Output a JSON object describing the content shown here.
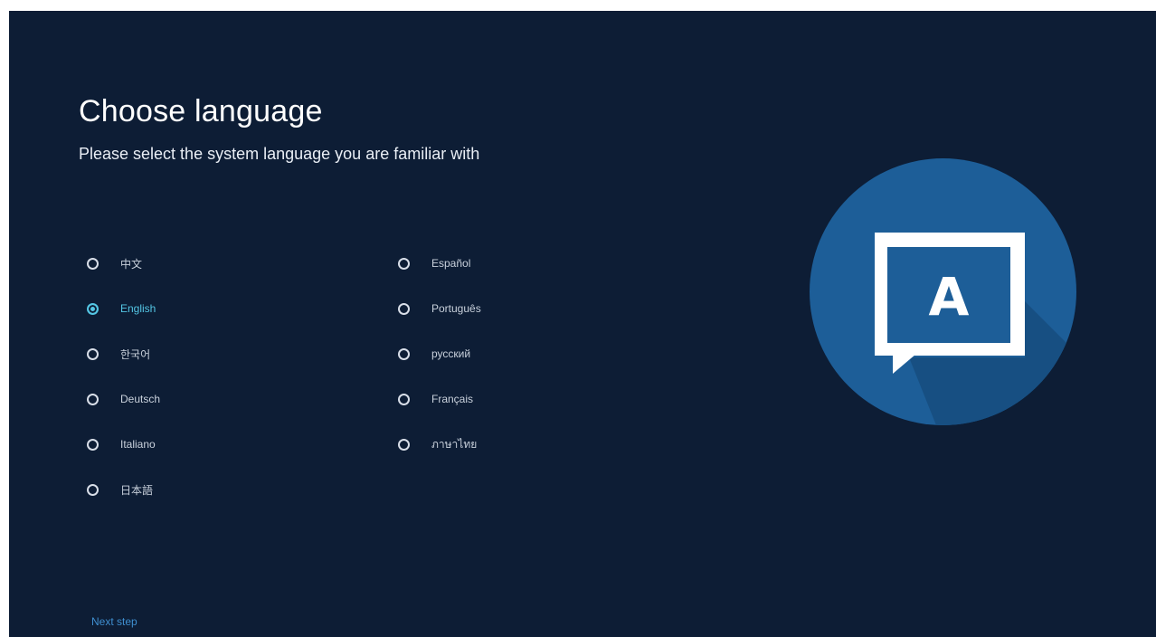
{
  "header": {
    "title": "Choose language",
    "subtitle": "Please select the system language you are familiar with"
  },
  "languages": [
    {
      "label": "中文",
      "selected": false
    },
    {
      "label": "English",
      "selected": true
    },
    {
      "label": "한국어",
      "selected": false
    },
    {
      "label": "Deutsch",
      "selected": false
    },
    {
      "label": "Italiano",
      "selected": false
    },
    {
      "label": "日本語",
      "selected": false
    },
    {
      "label": "Español",
      "selected": false
    },
    {
      "label": "Português",
      "selected": false
    },
    {
      "label": "русский",
      "selected": false
    },
    {
      "label": "Français",
      "selected": false
    },
    {
      "label": "ภาษาไทย",
      "selected": false
    }
  ],
  "footer": {
    "next_label": "Next step"
  },
  "illustration": {
    "glyph": "A",
    "icon": "language-icon"
  },
  "colors": {
    "background": "#0d1d35",
    "accent": "#54c6e4",
    "link": "#3f8fd0",
    "circle": "#1d5e98"
  }
}
